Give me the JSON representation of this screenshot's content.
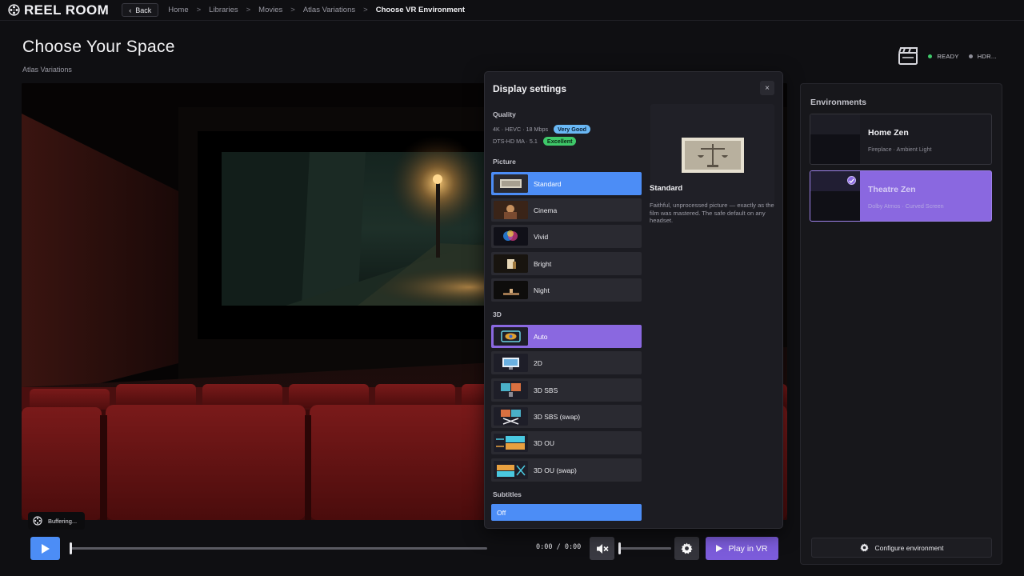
{
  "app": {
    "name": "REEL ROOM"
  },
  "nav": {
    "back_label": "Back",
    "breadcrumbs": [
      "Home",
      "Libraries",
      "Movies",
      "Atlas Variations",
      "Choose VR Environment"
    ],
    "separator": ">"
  },
  "header": {
    "title": "Choose Your Space",
    "subtitle": "Atlas Variations",
    "status": [
      {
        "label": "READY",
        "color": "#3fc96a"
      },
      {
        "label": "HDR...",
        "color": "#8e8e98"
      }
    ]
  },
  "scene": {
    "buffering_label": "Buffering..."
  },
  "player": {
    "time": "0:00 / 0:00",
    "progress": 0,
    "volume": 0,
    "muted": true,
    "play_vr_label": "Play in VR"
  },
  "display_settings": {
    "title": "Display settings",
    "close_label": "×",
    "quality": {
      "label": "Quality",
      "video": "4K · HEVC · 18 Mbps",
      "video_badge": "Very Good",
      "audio": "DTS-HD MA · 5.1",
      "audio_badge": "Excellent"
    },
    "picture": {
      "label": "Picture",
      "options": [
        "Standard",
        "Cinema",
        "Vivid",
        "Bright",
        "Night"
      ],
      "selected": "Standard"
    },
    "three_d": {
      "label": "3D",
      "options": [
        "Auto",
        "2D",
        "3D SBS",
        "3D SBS (swap)",
        "3D OU",
        "3D OU (swap)"
      ],
      "selected": "Auto"
    },
    "subtitles": {
      "label": "Subtitles",
      "value": "Off"
    },
    "preview": {
      "name": "Standard",
      "description": "Faithful, unprocessed picture — exactly as the film was mastered. The safe default on any headset."
    }
  },
  "environments": {
    "title": "Environments",
    "items": [
      {
        "name": "Home Zen",
        "desc": "Fireplace · Ambient Light",
        "selected": false
      },
      {
        "name": "Theatre Zen",
        "desc": "Dolby Atmos · Curved Screen",
        "selected": true
      }
    ],
    "configure_label": "Configure environment"
  },
  "colors": {
    "accent_blue": "#4c8df6",
    "accent_purple": "#8a68e0",
    "background": "#0f0f12"
  }
}
